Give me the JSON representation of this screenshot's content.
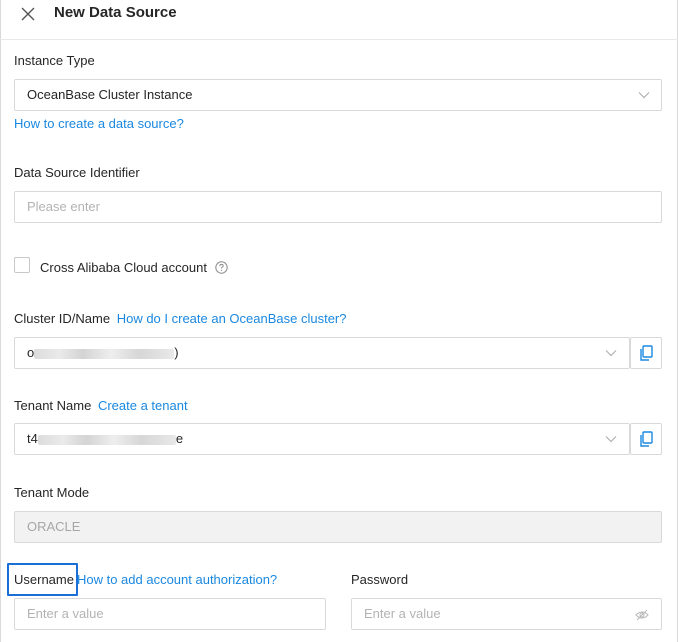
{
  "dialog": {
    "title": "New Data Source"
  },
  "instance_type": {
    "label": "Instance Type",
    "value": "OceanBase Cluster Instance",
    "help_link": "How to create a data source?"
  },
  "identifier": {
    "label": "Data Source Identifier",
    "placeholder": "Please enter"
  },
  "cross_account": {
    "label": "Cross Alibaba Cloud account"
  },
  "cluster": {
    "label": "Cluster ID/Name",
    "help_link": "How do I create an OceanBase cluster?",
    "value_prefix": "o",
    "value_suffix": ")"
  },
  "tenant": {
    "label": "Tenant Name",
    "help_link": "Create a tenant",
    "value_prefix": "t4",
    "value_suffix": "e"
  },
  "tenant_mode": {
    "label": "Tenant Mode",
    "value": "ORACLE"
  },
  "username": {
    "label": "Username",
    "help_link": "How to add account authorization?",
    "placeholder": "Enter a value"
  },
  "password": {
    "label": "Password",
    "placeholder": "Enter a value"
  },
  "colors": {
    "link": "#1a88e0",
    "highlight": "#1a6fd6",
    "border": "#d9d9d9",
    "disabled_bg": "#f2f2f2"
  }
}
